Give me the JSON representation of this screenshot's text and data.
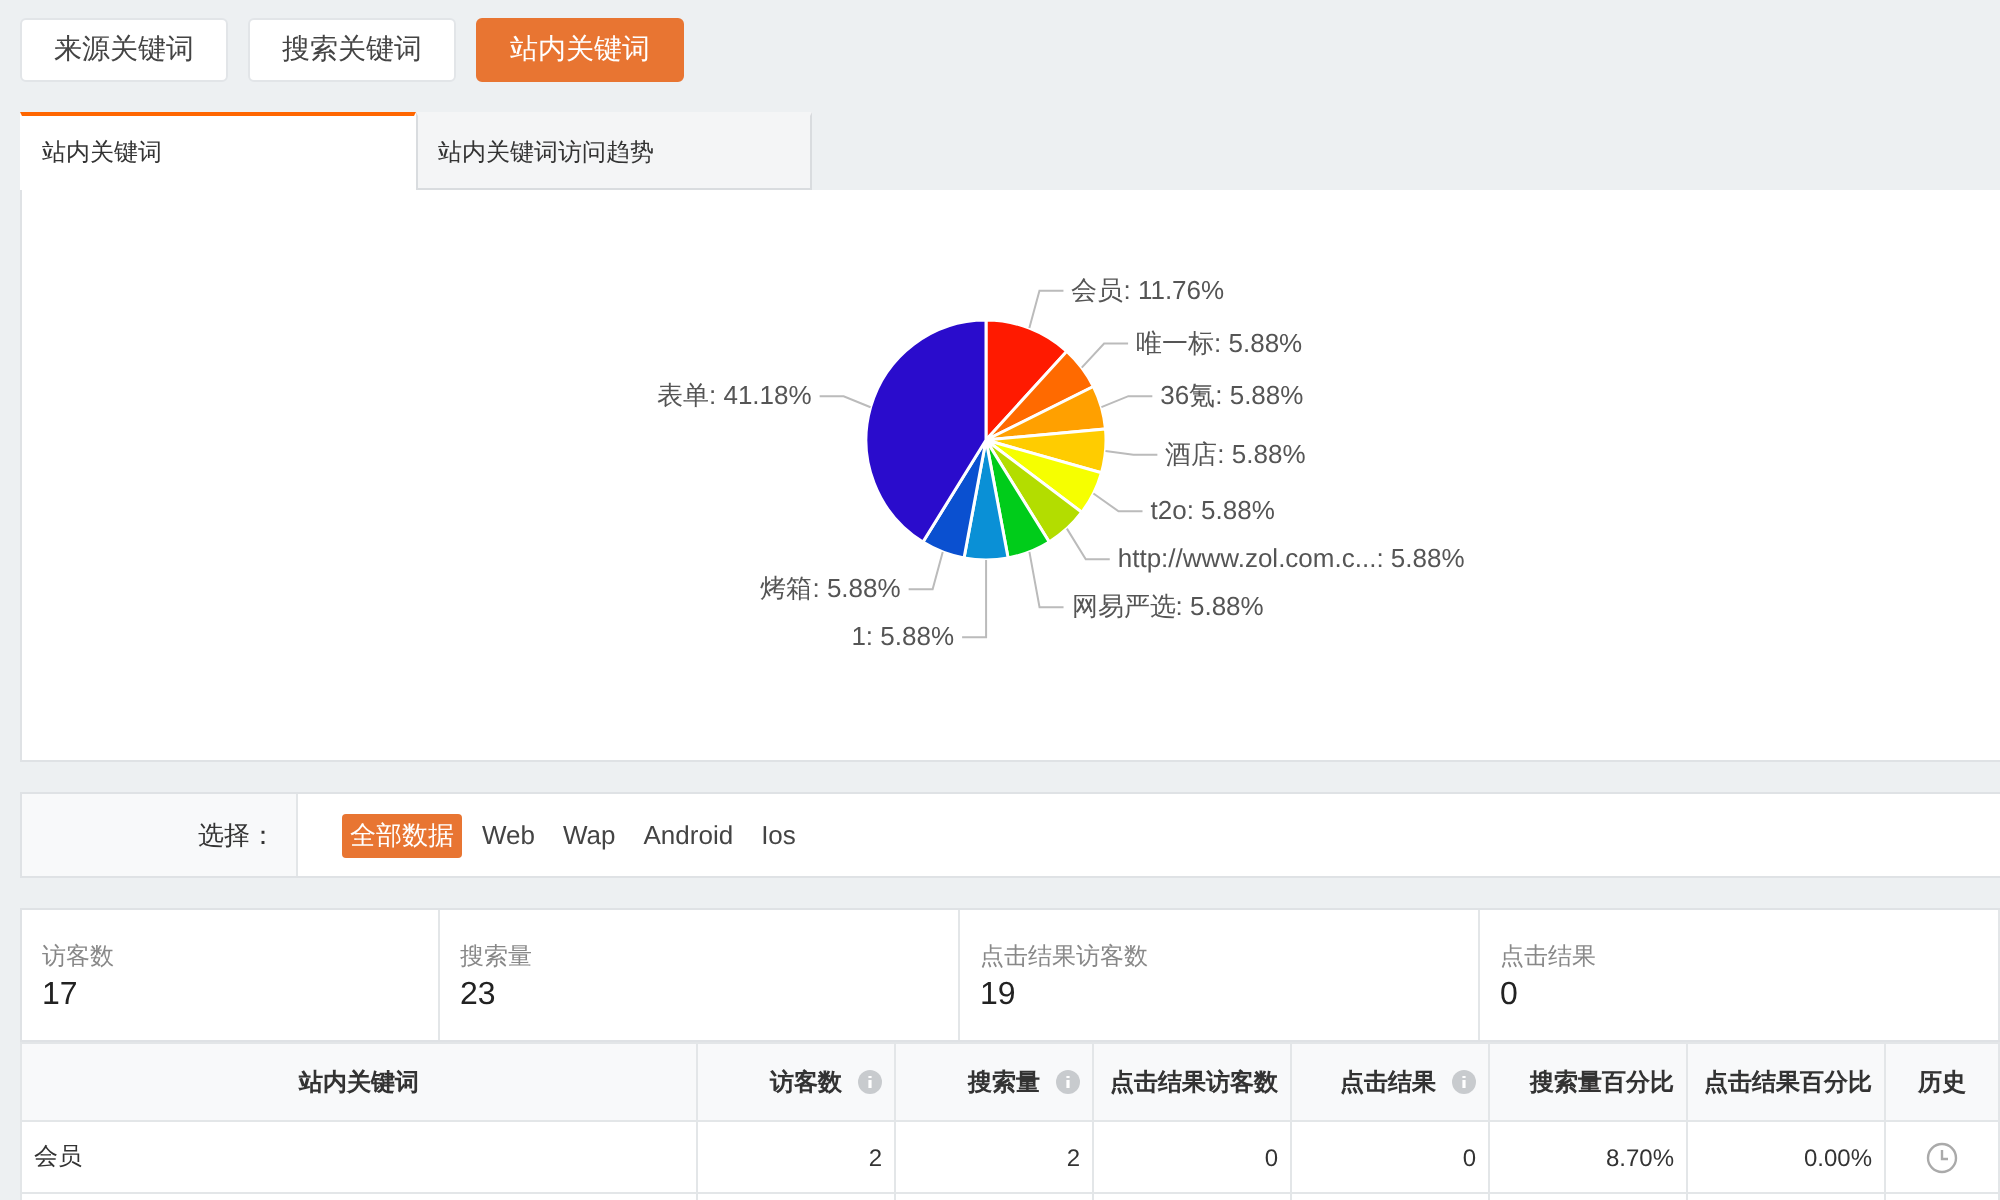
{
  "top_buttons": [
    {
      "label": "来源关键词",
      "selected": false
    },
    {
      "label": "搜索关键词",
      "selected": false
    },
    {
      "label": "站内关键词",
      "selected": true
    }
  ],
  "tabs": [
    {
      "label": "站内关键词",
      "selected": true
    },
    {
      "label": "站内关键词访问趋势",
      "selected": false
    }
  ],
  "chart_data": {
    "type": "pie",
    "categories": [
      "会员: 11.76%",
      "唯一标: 5.88%",
      "36氪: 5.88%",
      "酒店: 5.88%",
      "t2o: 5.88%",
      "http://www.zol.com.c...: 5.88%",
      "网易严选: 5.88%",
      "1: 5.88%",
      "烤箱: 5.88%",
      "表单: 41.18%"
    ],
    "values": [
      11.76,
      5.88,
      5.88,
      5.88,
      5.88,
      5.88,
      5.88,
      5.88,
      5.88,
      41.18
    ]
  },
  "filter": {
    "label": "选择：",
    "options": [
      {
        "label": "全部数据",
        "selected": true
      },
      {
        "label": "Web",
        "selected": false
      },
      {
        "label": "Wap",
        "selected": false
      },
      {
        "label": "Android",
        "selected": false
      },
      {
        "label": "Ios",
        "selected": false
      }
    ]
  },
  "stats": [
    {
      "label": "访客数",
      "value": "17"
    },
    {
      "label": "搜索量",
      "value": "23"
    },
    {
      "label": "点击结果访客数",
      "value": "19"
    },
    {
      "label": "点击结果",
      "value": "0"
    }
  ],
  "table": {
    "columns": [
      {
        "label": "站内关键词",
        "info": false
      },
      {
        "label": "访客数",
        "info": true
      },
      {
        "label": "搜索量",
        "info": true
      },
      {
        "label": "点击结果访客数",
        "info": false
      },
      {
        "label": "点击结果",
        "info": true
      },
      {
        "label": "搜索量百分比",
        "info": false
      },
      {
        "label": "点击结果百分比",
        "info": false
      },
      {
        "label": "历史",
        "info": false
      }
    ],
    "rows": [
      {
        "cells": [
          "会员",
          "2",
          "2",
          "0",
          "0",
          "8.70%",
          "0.00%"
        ],
        "history": true
      }
    ]
  }
}
